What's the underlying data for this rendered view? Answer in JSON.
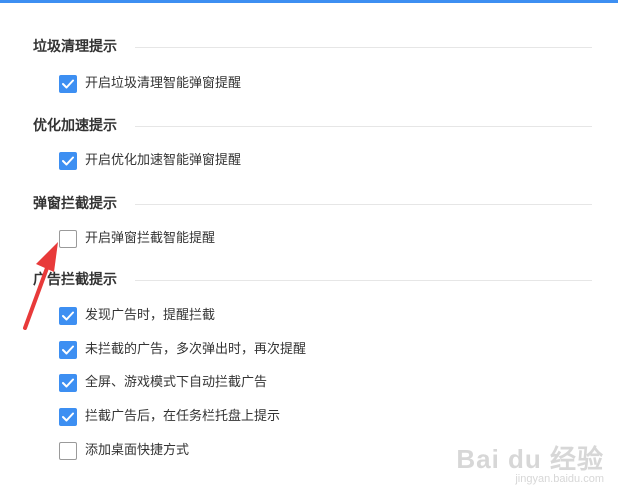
{
  "colors": {
    "accent": "#3d8ff2",
    "arrow": "#e83a3a",
    "topbar": "#3d8ff2"
  },
  "sections": [
    {
      "title": "垃圾清理提示",
      "options": [
        {
          "label": "开启垃圾清理智能弹窗提醒",
          "checked": true
        }
      ]
    },
    {
      "title": "优化加速提示",
      "options": [
        {
          "label": "开启优化加速智能弹窗提醒",
          "checked": true
        }
      ]
    },
    {
      "title": "弹窗拦截提示",
      "options": [
        {
          "label": "开启弹窗拦截智能提醒",
          "checked": false
        }
      ]
    },
    {
      "title": "广告拦截提示",
      "options": [
        {
          "label": "发现广告时，提醒拦截",
          "checked": true
        },
        {
          "label": "未拦截的广告，多次弹出时，再次提醒",
          "checked": true
        },
        {
          "label": "全屏、游戏模式下自动拦截广告",
          "checked": true
        },
        {
          "label": "拦截广告后，在任务栏托盘上提示",
          "checked": true
        },
        {
          "label": "添加桌面快捷方式",
          "checked": false
        }
      ]
    }
  ],
  "watermark": {
    "main": "Bai du 经验",
    "sub": "jingyan.baidu.com"
  }
}
